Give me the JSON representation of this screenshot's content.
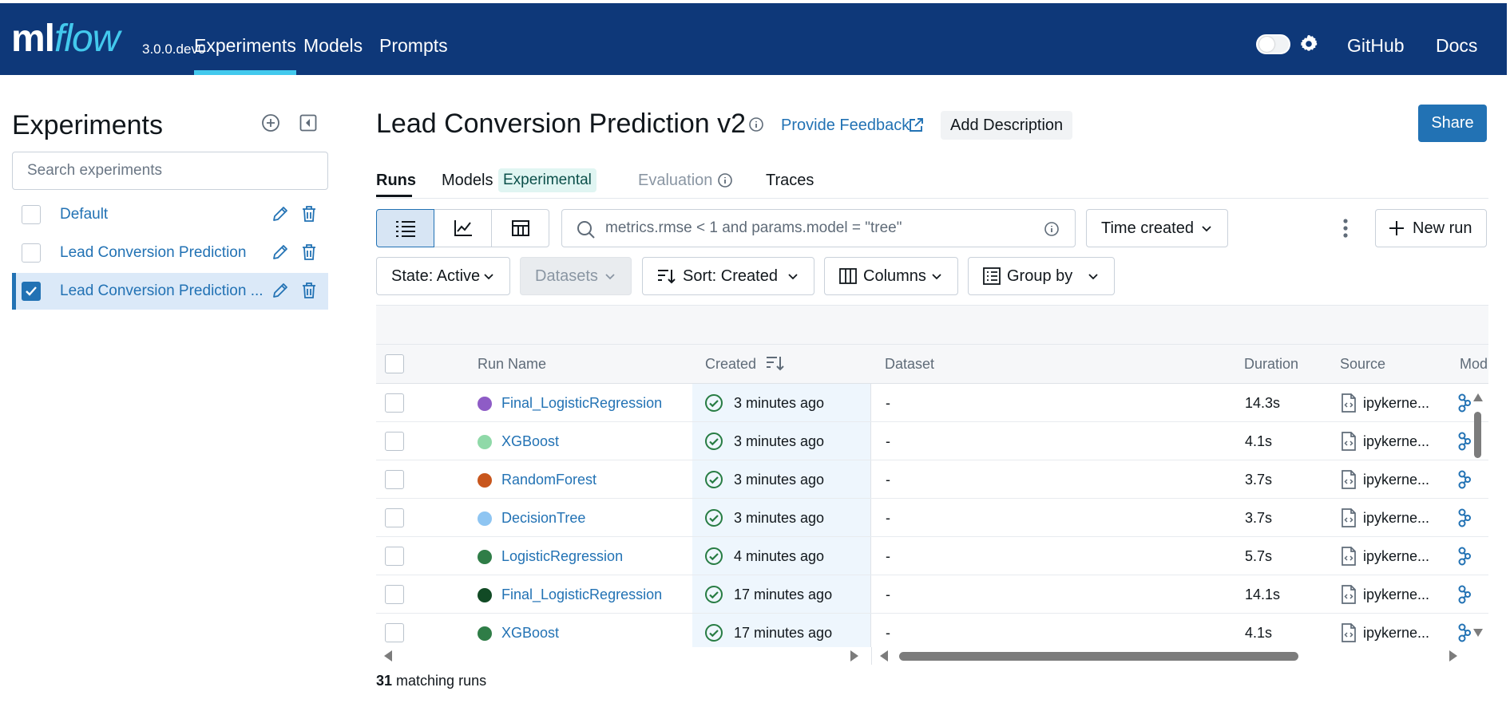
{
  "app": {
    "logo_ml": "ml",
    "logo_flow": "flow",
    "version": "3.0.0.dev0",
    "nav_tabs": [
      {
        "label": "Experiments",
        "active": true
      },
      {
        "label": "Models",
        "active": false
      },
      {
        "label": "Prompts",
        "active": false
      }
    ],
    "right_links": {
      "github": "GitHub",
      "docs": "Docs"
    },
    "theme_toggle_on": false
  },
  "sidebar": {
    "title": "Experiments",
    "search_placeholder": "Search experiments",
    "experiments": [
      {
        "name": "Default",
        "selected": false
      },
      {
        "name": "Lead Conversion Prediction",
        "selected": false
      },
      {
        "name": "Lead Conversion Prediction ...",
        "selected": true
      }
    ]
  },
  "main": {
    "title": "Lead Conversion Prediction v2",
    "feedback_label": "Provide Feedback",
    "add_description_label": "Add Description",
    "share_label": "Share",
    "tabs": {
      "runs": "Runs",
      "models": "Models",
      "experimental_badge": "Experimental",
      "evaluation": "Evaluation",
      "traces": "Traces"
    },
    "filter_value": "metrics.rmse < 1 and params.model = \"tree\"",
    "time_created_label": "Time created",
    "new_run_label": "New run",
    "state_label": "State: Active",
    "datasets_label": "Datasets",
    "sort_label": "Sort: Created",
    "columns_label": "Columns",
    "group_by_label": "Group by"
  },
  "table": {
    "headers": {
      "run_name": "Run Name",
      "created": "Created",
      "dataset": "Dataset",
      "duration": "Duration",
      "source": "Source",
      "models": "Mod"
    },
    "rows": [
      {
        "name": "Final_LogisticRegression",
        "color": "#8e5cc6",
        "created": "3 minutes ago",
        "dataset": "-",
        "duration": "14.3s",
        "source": "ipykerne..."
      },
      {
        "name": "XGBoost",
        "color": "#8fd9a8",
        "created": "3 minutes ago",
        "dataset": "-",
        "duration": "4.1s",
        "source": "ipykerne..."
      },
      {
        "name": "RandomForest",
        "color": "#c8561d",
        "created": "3 minutes ago",
        "dataset": "-",
        "duration": "3.7s",
        "source": "ipykerne..."
      },
      {
        "name": "DecisionTree",
        "color": "#8ec5f2",
        "created": "3 minutes ago",
        "dataset": "-",
        "duration": "3.7s",
        "source": "ipykerne..."
      },
      {
        "name": "LogisticRegression",
        "color": "#2f7d47",
        "created": "4 minutes ago",
        "dataset": "-",
        "duration": "5.7s",
        "source": "ipykerne..."
      },
      {
        "name": "Final_LogisticRegression",
        "color": "#114a25",
        "created": "17 minutes ago",
        "dataset": "-",
        "duration": "14.1s",
        "source": "ipykerne..."
      },
      {
        "name": "XGBoost",
        "color": "#2f7d47",
        "created": "17 minutes ago",
        "dataset": "-",
        "duration": "4.1s",
        "source": "ipykerne..."
      }
    ],
    "matching_count": "31",
    "matching_suffix": " matching runs"
  },
  "colors": {
    "nav_bg": "#0e3879",
    "accent": "#2272b4",
    "logo_cyan": "#43c9ed",
    "success": "#277c43"
  }
}
